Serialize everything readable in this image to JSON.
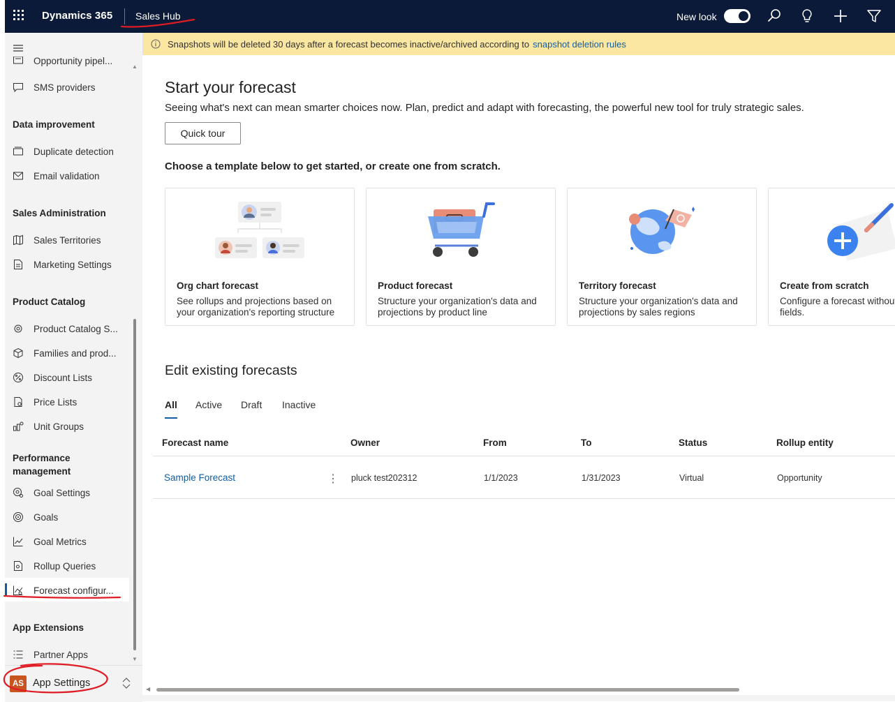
{
  "topbar": {
    "brand": "Dynamics 365",
    "app_name": "Sales Hub",
    "new_look_label": "New look",
    "icons": [
      "waffle-icon",
      "search-icon",
      "lightbulb-icon",
      "plus-icon",
      "filter-icon"
    ]
  },
  "banner": {
    "text": "Snapshots will be deleted 30 days after a forecast becomes inactive/archived according to",
    "link": "snapshot deletion rules"
  },
  "sidebar": {
    "items_top": [
      {
        "label": "Opportunity pipel...",
        "icon": "pipeline-icon"
      },
      {
        "label": "SMS providers",
        "icon": "chat-icon"
      }
    ],
    "groups": [
      {
        "title": "Data improvement",
        "items": [
          {
            "label": "Duplicate detection",
            "icon": "duplicate-icon"
          },
          {
            "label": "Email validation",
            "icon": "mail-icon"
          }
        ]
      },
      {
        "title": "Sales Administration",
        "items": [
          {
            "label": "Sales Territories",
            "icon": "map-icon"
          },
          {
            "label": "Marketing Settings",
            "icon": "document-icon"
          }
        ]
      },
      {
        "title": "Product Catalog",
        "items": [
          {
            "label": "Product Catalog S...",
            "icon": "settings-icon"
          },
          {
            "label": "Families and prod...",
            "icon": "box-icon"
          },
          {
            "label": "Discount Lists",
            "icon": "percent-icon"
          },
          {
            "label": "Price Lists",
            "icon": "price-icon"
          },
          {
            "label": "Unit Groups",
            "icon": "units-icon"
          }
        ]
      },
      {
        "title": "Performance management",
        "items": [
          {
            "label": "Goal Settings",
            "icon": "goal-settings-icon"
          },
          {
            "label": "Goals",
            "icon": "target-icon"
          },
          {
            "label": "Goal Metrics",
            "icon": "chart-icon"
          },
          {
            "label": "Rollup Queries",
            "icon": "query-icon"
          },
          {
            "label": "Forecast configur...",
            "icon": "forecast-icon"
          }
        ]
      },
      {
        "title": "App Extensions",
        "items": [
          {
            "label": "Partner Apps",
            "icon": "list-icon"
          }
        ]
      }
    ],
    "footer": {
      "avatar": "AS",
      "label": "App Settings"
    }
  },
  "main": {
    "title": "Start your forecast",
    "subtitle": "Seeing what's next can mean smarter choices now. Plan, predict and adapt with forecasting, the powerful new tool for truly strategic sales.",
    "quick_tour": "Quick tour",
    "choose": "Choose a template below to get started, or create one from scratch.",
    "cards": [
      {
        "title": "Org chart forecast",
        "desc": "See rollups and projections based on your organization's reporting structure"
      },
      {
        "title": "Product forecast",
        "desc": "Structure your organization's data and projections by product line"
      },
      {
        "title": "Territory forecast",
        "desc": "Structure your organization's data and projections by sales regions"
      },
      {
        "title": "Create from scratch",
        "desc": "Configure a forecast without populated fields."
      }
    ],
    "edit_title": "Edit existing forecasts",
    "tabs": [
      "All",
      "Active",
      "Draft",
      "Inactive"
    ],
    "table": {
      "headers": [
        "Forecast name",
        "Owner",
        "From",
        "To",
        "Status",
        "Rollup entity"
      ],
      "rows": [
        {
          "name": "Sample Forecast",
          "owner": "pluck test202312",
          "from": "1/1/2023",
          "to": "1/31/2023",
          "status": "Virtual",
          "rollup": "Opportunity"
        }
      ]
    }
  },
  "colors": {
    "topbar": "#0b1a38",
    "banner": "#fbe6a2",
    "link": "#115ea3",
    "annotation": "#e01b24"
  }
}
